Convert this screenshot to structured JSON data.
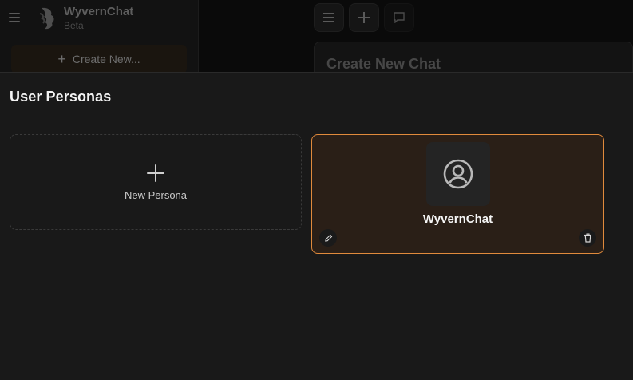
{
  "app": {
    "title": "WyvernChat",
    "subtitle": "Beta",
    "create_button_label": "Create New...",
    "main_card_title": "Create New Chat"
  },
  "modal": {
    "title": "User Personas",
    "new_persona_label": "New Persona",
    "personas": [
      {
        "name": "WyvernChat",
        "selected": true
      }
    ]
  },
  "icons": {
    "menu": "menu-icon",
    "logo": "wyvern-logo-icon",
    "plus": "plus-icon",
    "chat": "chat-bubble-icon",
    "avatar": "user-circle-icon",
    "edit": "pencil-icon",
    "delete": "trash-icon"
  },
  "colors": {
    "accent": "#e08a3c",
    "selected_card_bg": "#2a1f17",
    "modal_bg": "#191919"
  }
}
